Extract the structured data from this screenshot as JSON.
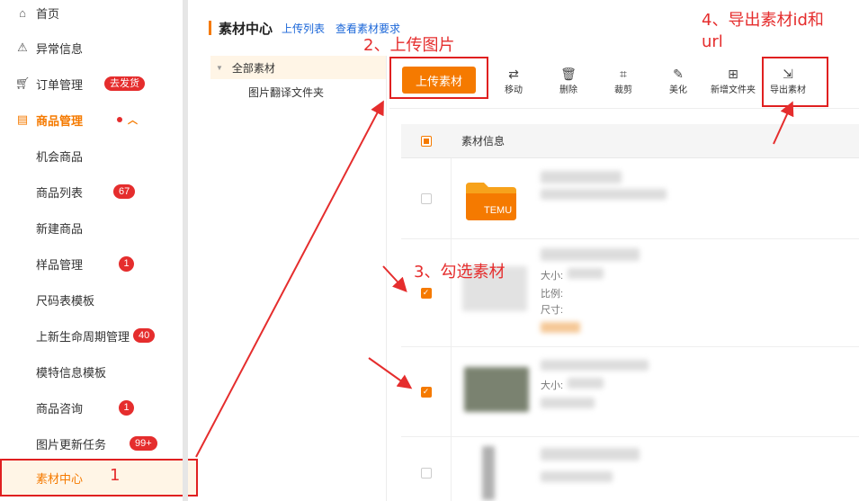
{
  "sidebar": {
    "items": [
      {
        "label": "首页",
        "icon": "home-icon"
      },
      {
        "label": "异常信息",
        "icon": "warning-icon"
      },
      {
        "label": "订单管理",
        "icon": "cart-icon",
        "badge": "去发货"
      },
      {
        "label": "商品管理",
        "icon": "product-icon"
      },
      {
        "label": "机会商品"
      },
      {
        "label": "商品列表",
        "badge": "67"
      },
      {
        "label": "新建商品"
      },
      {
        "label": "样品管理",
        "badge": "1"
      },
      {
        "label": "尺码表模板"
      },
      {
        "label": "上新生命周期管理",
        "badge": "40"
      },
      {
        "label": "模特信息模板"
      },
      {
        "label": "商品咨询",
        "badge": "1"
      },
      {
        "label": "图片更新任务",
        "badge": "99+"
      },
      {
        "label": "素材中心"
      }
    ]
  },
  "header": {
    "title": "素材中心",
    "link_upload_list": "上传列表",
    "link_requirements": "查看素材要求"
  },
  "tree": {
    "root": "全部素材",
    "child": "图片翻译文件夹"
  },
  "toolbar": {
    "upload": "上传素材",
    "move": "移动",
    "delete": "删除",
    "crop": "裁剪",
    "beautify": "美化",
    "new_folder": "新增文件夹",
    "export": "导出素材"
  },
  "table": {
    "header": "素材信息",
    "folder_label": "TEMU",
    "meta_size": "大小:",
    "meta_ratio": "比例:",
    "meta_dim": "尺寸:"
  },
  "annotations": {
    "step1": "1",
    "step2": "2、上传图片",
    "step3": "3、勾选素材",
    "step4_line1": "4、导出素材id和",
    "step4_line2": "url"
  },
  "colors": {
    "accent": "#f57a00",
    "annotation": "#e52d2d",
    "link": "#1a66d8"
  }
}
